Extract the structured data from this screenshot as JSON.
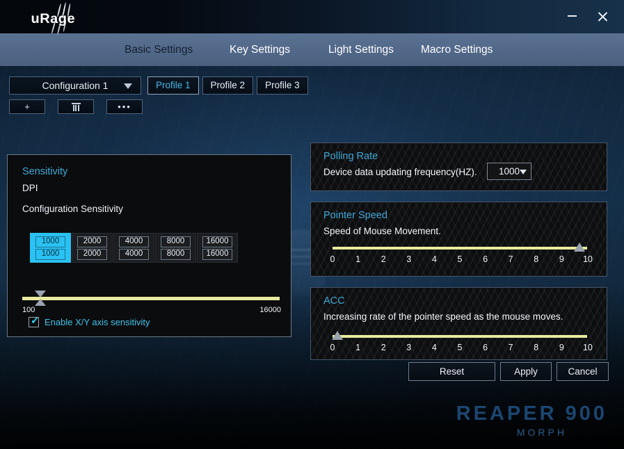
{
  "window": {
    "logo_text": "uRage",
    "minimize_label": "–",
    "close_label": "×"
  },
  "nav": {
    "tabs": [
      {
        "label": "Basic Settings",
        "active": true
      },
      {
        "label": "Key Settings",
        "active": false
      },
      {
        "label": "Light Settings",
        "active": false
      },
      {
        "label": "Macro Settings",
        "active": false
      }
    ]
  },
  "config": {
    "selected": "Configuration 1",
    "profiles": [
      {
        "label": "Profile 1",
        "active": true
      },
      {
        "label": "Profile 2",
        "active": false
      },
      {
        "label": "Profile 3",
        "active": false
      }
    ],
    "add_label": "+",
    "delete_label": "",
    "more_label": "•••"
  },
  "sensitivity": {
    "title": "Sensitivity",
    "dpi_label": "DPI",
    "configuration_label": "Configuration Sensitivity",
    "presets": [
      {
        "x": "1000",
        "y": "1000",
        "selected": true
      },
      {
        "x": "2000",
        "y": "2000",
        "selected": false
      },
      {
        "x": "4000",
        "y": "4000",
        "selected": false
      },
      {
        "x": "8000",
        "y": "8000",
        "selected": false
      },
      {
        "x": "16000",
        "y": "16000",
        "selected": false
      }
    ],
    "slider": {
      "min_label": "100",
      "max_label": "16000",
      "value_percent": 7
    },
    "checkbox": {
      "label": "Enable X/Y axis sensitivity",
      "checked": true,
      "mark": "✓"
    }
  },
  "polling": {
    "title": "Polling Rate",
    "description": "Device data updating frequency(HZ).",
    "selected": "1000"
  },
  "pointer": {
    "title": "Pointer Speed",
    "description": "Speed of Mouse Movement.",
    "ticks": [
      "0",
      "1",
      "2",
      "3",
      "4",
      "5",
      "6",
      "7",
      "8",
      "9",
      "10"
    ],
    "value_percent": 97
  },
  "acc": {
    "title": "ACC",
    "description": "Increasing rate of the pointer speed as the mouse moves.",
    "ticks": [
      "0",
      "1",
      "2",
      "3",
      "4",
      "5",
      "6",
      "7",
      "8",
      "9",
      "10"
    ],
    "value_percent": 2
  },
  "actions": {
    "reset": "Reset",
    "apply": "Apply",
    "cancel": "Cancel"
  },
  "branding": {
    "main": "REAPER 900",
    "sub": "MORPH"
  },
  "colors": {
    "accent_cyan": "#3fa9d8",
    "selected_dpi": "#29c2f2",
    "slider_track": "#e8eb9e",
    "navbar": "#53698a"
  }
}
